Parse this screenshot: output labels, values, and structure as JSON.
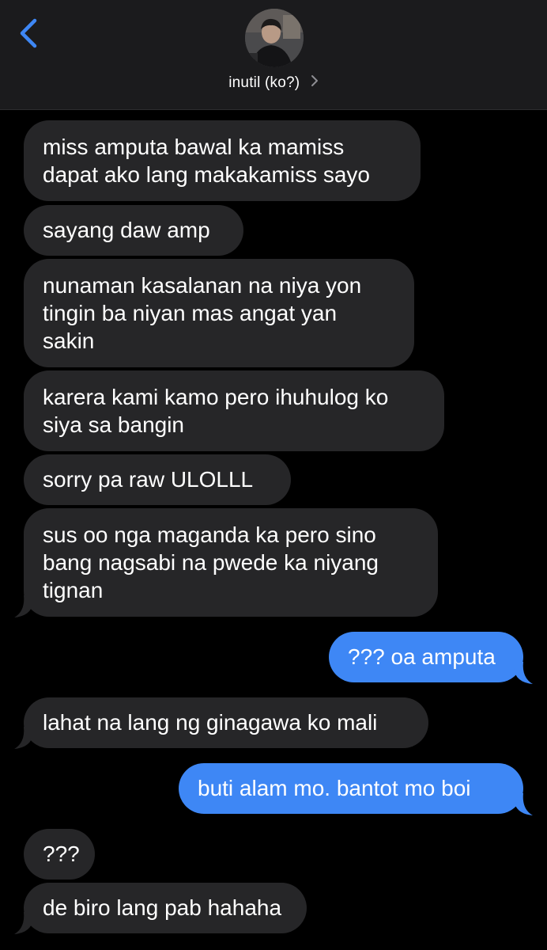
{
  "header": {
    "contact_name": "inutil (ko?)",
    "back_icon": "chevron-left-icon",
    "info_icon": "chevron-right-icon",
    "accent_color": "#3e87f5"
  },
  "messages": [
    {
      "direction": "incoming",
      "lines": [
        "miss amputa bawal ka mamiss",
        "dapat ako lang makakamiss sayo"
      ]
    },
    {
      "direction": "incoming",
      "lines": [
        "sayang daw amp"
      ]
    },
    {
      "direction": "incoming",
      "lines": [
        "nunaman kasalanan na niya yon",
        "tingin ba niyan mas angat yan",
        "sakin"
      ]
    },
    {
      "direction": "incoming",
      "lines": [
        "karera kami kamo pero ihuhulog ko",
        "siya sa bangin"
      ]
    },
    {
      "direction": "incoming",
      "lines": [
        "sorry pa raw ULOLLL"
      ]
    },
    {
      "direction": "incoming",
      "lines": [
        "sus oo nga maganda ka pero sino",
        "bang nagsabi na pwede ka niyang",
        "tignan"
      ]
    },
    {
      "direction": "outgoing",
      "lines": [
        "??? oa amputa"
      ]
    },
    {
      "direction": "incoming",
      "lines": [
        "lahat na lang ng ginagawa ko mali"
      ]
    },
    {
      "direction": "outgoing",
      "lines": [
        "buti alam mo. bantot mo boi"
      ]
    },
    {
      "direction": "incoming",
      "lines": [
        "???"
      ]
    },
    {
      "direction": "incoming",
      "lines": [
        "de biro lang pab hahaha"
      ]
    }
  ],
  "colors": {
    "incoming_bubble": "#262628",
    "outgoing_bubble": "#3e87f5",
    "header_bg": "#1b1b1d",
    "background": "#000000"
  }
}
